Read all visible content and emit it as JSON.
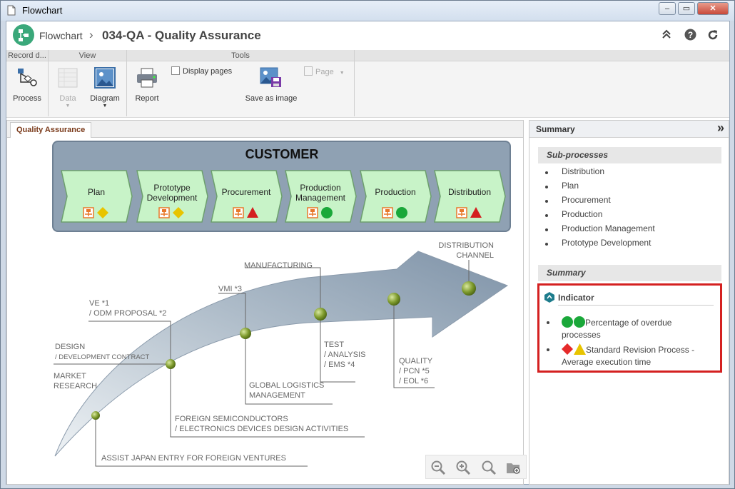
{
  "window": {
    "title": "Flowchart",
    "minimize": "–",
    "restore": "▭",
    "close": "✕"
  },
  "header": {
    "breadcrumb_root": "Flowchart",
    "separator": "›",
    "record_title": "034-QA - Quality Assurance"
  },
  "ribbon": {
    "groups": [
      "Record d...",
      "View",
      "Tools"
    ],
    "process_label": "Process",
    "data_label": "Data",
    "diagram_label": "Diagram",
    "report_label": "Report",
    "display_pages_label": "Display pages",
    "save_as_image_label": "Save as image",
    "page_label": "Page"
  },
  "tabs": [
    {
      "label": "Quality Assurance",
      "active": true
    }
  ],
  "diagram": {
    "title": "CUSTOMER",
    "stages": [
      {
        "label": "Plan",
        "status": "yellow-diamond"
      },
      {
        "label": "Prototype Development",
        "status": "yellow-diamond"
      },
      {
        "label": "Procurement",
        "status": "red-triangle"
      },
      {
        "label": "Production Management",
        "status": "green-circle"
      },
      {
        "label": "Production",
        "status": "green-circle"
      },
      {
        "label": "Distribution",
        "status": "red-triangle"
      }
    ],
    "arrow_labels": {
      "market_research": [
        "MARKET",
        "RESEARCH"
      ],
      "design": [
        "DESIGN",
        "/ DEVELOPMENT CONTRACT"
      ],
      "ve": [
        "VE *1",
        "/ ODM PROPOSAL *2"
      ],
      "vmi": "VMI *3",
      "manufacturing": "MANUFACTURING",
      "distribution_channel": [
        "DISTRIBUTION",
        "CHANNEL"
      ],
      "test": [
        "TEST",
        "/ ANALYSIS",
        "/ EMS *4"
      ],
      "quality": [
        "QUALITY",
        "/ PCN *5",
        "/ EOL *6"
      ],
      "global_logistics": [
        "GLOBAL LOGISTICS",
        "MANAGEMENT"
      ],
      "foreign_semis": [
        "FOREIGN SEMICONDUCTORS",
        "/ ELECTRONICS DEVICES DESIGN ACTIVITIES"
      ],
      "assist_japan": "ASSIST JAPAN ENTRY FOR FOREIGN VENTURES"
    }
  },
  "summary_panel": {
    "title": "Summary",
    "collapse_glyph": "»",
    "subprocesses_heading": "Sub-processes",
    "subprocesses": [
      "Distribution",
      "Plan",
      "Procurement",
      "Production",
      "Production Management",
      "Prototype Development"
    ],
    "summary_heading": "Summary",
    "indicator_heading": "Indicator",
    "indicators": [
      {
        "text_line1": "Percentage of overdue",
        "text_line2": "processes",
        "markers": [
          "green-circle",
          "green-circle"
        ]
      },
      {
        "text_line1": "Standard Revision Process -",
        "text_line2": "Average execution time",
        "markers": [
          "red-diamond",
          "yellow-triangle"
        ]
      }
    ]
  },
  "colors": {
    "accent_red": "#d42020",
    "green": "#1aa83a",
    "yellow": "#e8c400",
    "stage_fill": "#c8f3c8",
    "customer_panel": "#8fa1b3"
  }
}
